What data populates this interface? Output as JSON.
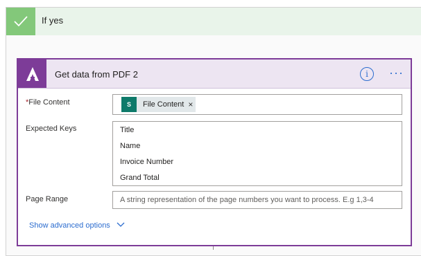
{
  "branch": {
    "title": "If yes",
    "icon": "check-icon",
    "header_color": "#e9f4ea",
    "icon_bg_color": "#83c87a"
  },
  "card": {
    "title": "Get data from PDF 2",
    "icon": "pdf-connector-logo-icon",
    "accent_color": "#7d3c98",
    "info_icon": "info-icon",
    "more_icon": "more-options-icon",
    "more_glyph": "···"
  },
  "fields": {
    "file_content": {
      "required_marker": "*",
      "label": "File Content",
      "token": {
        "icon": "sharepoint-icon",
        "icon_text": "S",
        "text": "File Content",
        "remove_glyph": "×"
      }
    },
    "expected_keys": {
      "label": "Expected Keys",
      "items": [
        "Title",
        "Name",
        "Invoice Number",
        "Grand Total"
      ]
    },
    "page_range": {
      "label": "Page Range",
      "placeholder": "A string representation of the page numbers you want to process. E.g 1,3-4"
    }
  },
  "advanced": {
    "label": "Show advanced options",
    "icon": "chevron-down-icon"
  }
}
